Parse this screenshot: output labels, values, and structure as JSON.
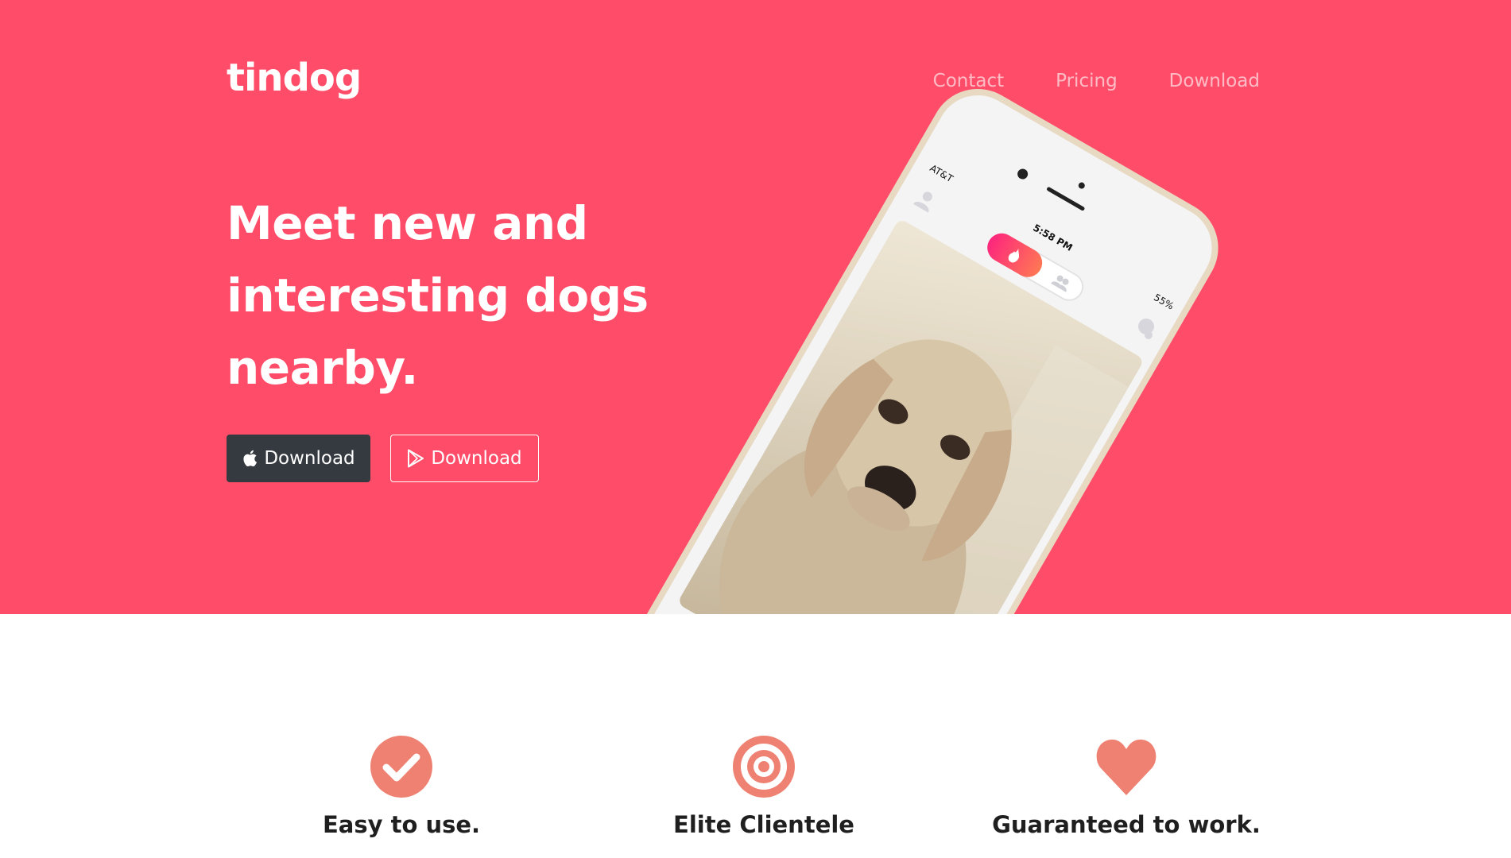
{
  "brand": "tindog",
  "nav": {
    "items": [
      {
        "label": "Contact"
      },
      {
        "label": "Pricing"
      },
      {
        "label": "Download"
      }
    ]
  },
  "hero": {
    "headline": "Meet new and interesting dogs nearby.",
    "buttons": [
      {
        "label": "Download",
        "icon": "apple-icon",
        "style": "dark"
      },
      {
        "label": "Download",
        "icon": "google-play-icon",
        "style": "outline"
      }
    ]
  },
  "phone": {
    "carrier": "AT&T",
    "time": "5:58 PM",
    "battery": "55%"
  },
  "features": [
    {
      "title": "Easy to use.",
      "icon": "check-circle-icon"
    },
    {
      "title": "Elite Clientele",
      "icon": "bullseye-icon"
    },
    {
      "title": "Guaranteed to work.",
      "icon": "heart-icon"
    }
  ],
  "colors": {
    "hero_bg": "#ff4c68",
    "accent_icon": "#ef8172",
    "dark_button": "#343a40",
    "heading_text": "#1f1f1f"
  }
}
